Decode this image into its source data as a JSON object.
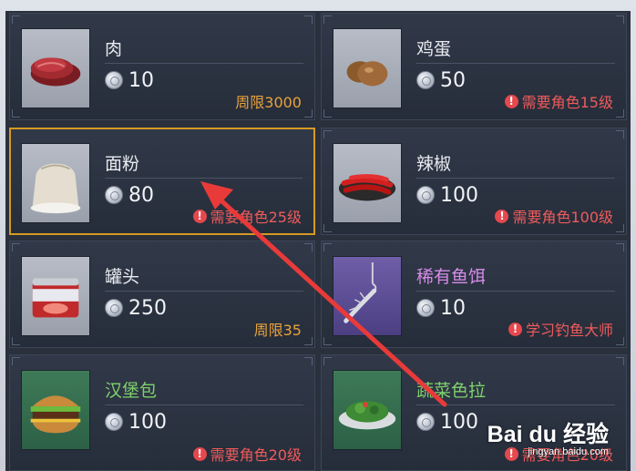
{
  "items": [
    {
      "name": "肉",
      "price": "10",
      "note": "周限3000",
      "note_type": "limit",
      "icon": "meat-icon"
    },
    {
      "name": "鸡蛋",
      "price": "50",
      "note": "需要角色15级",
      "note_type": "requirement",
      "icon": "egg-icon"
    },
    {
      "name": "面粉",
      "price": "80",
      "note": "需要角色25级",
      "note_type": "requirement",
      "icon": "flour-sack-icon",
      "selected": true
    },
    {
      "name": "辣椒",
      "price": "100",
      "note": "需要角色100级",
      "note_type": "requirement",
      "icon": "chili-pepper-icon"
    },
    {
      "name": "罐头",
      "price": "250",
      "note": "周限35",
      "note_type": "limit",
      "icon": "canned-food-icon"
    },
    {
      "name": "稀有鱼饵",
      "price": "10",
      "note": "学习钓鱼大师",
      "note_type": "requirement",
      "icon": "fish-bait-icon"
    },
    {
      "name": "汉堡包",
      "price": "100",
      "note": "需要角色20级",
      "note_type": "requirement",
      "icon": "burger-icon"
    },
    {
      "name": "蔬菜色拉",
      "price": "100",
      "note": "需要角色20级",
      "note_type": "requirement",
      "icon": "salad-icon"
    }
  ],
  "warning_glyph": "!",
  "colors": {
    "limit_text": "#e8a23a",
    "requirement_text": "#ef5b5b",
    "selected_border": "#d69a22",
    "annotation_arrow": "#e93a3a"
  },
  "watermark": {
    "logo": "Bai du 经验",
    "url": "jingyan.baidu.com"
  }
}
